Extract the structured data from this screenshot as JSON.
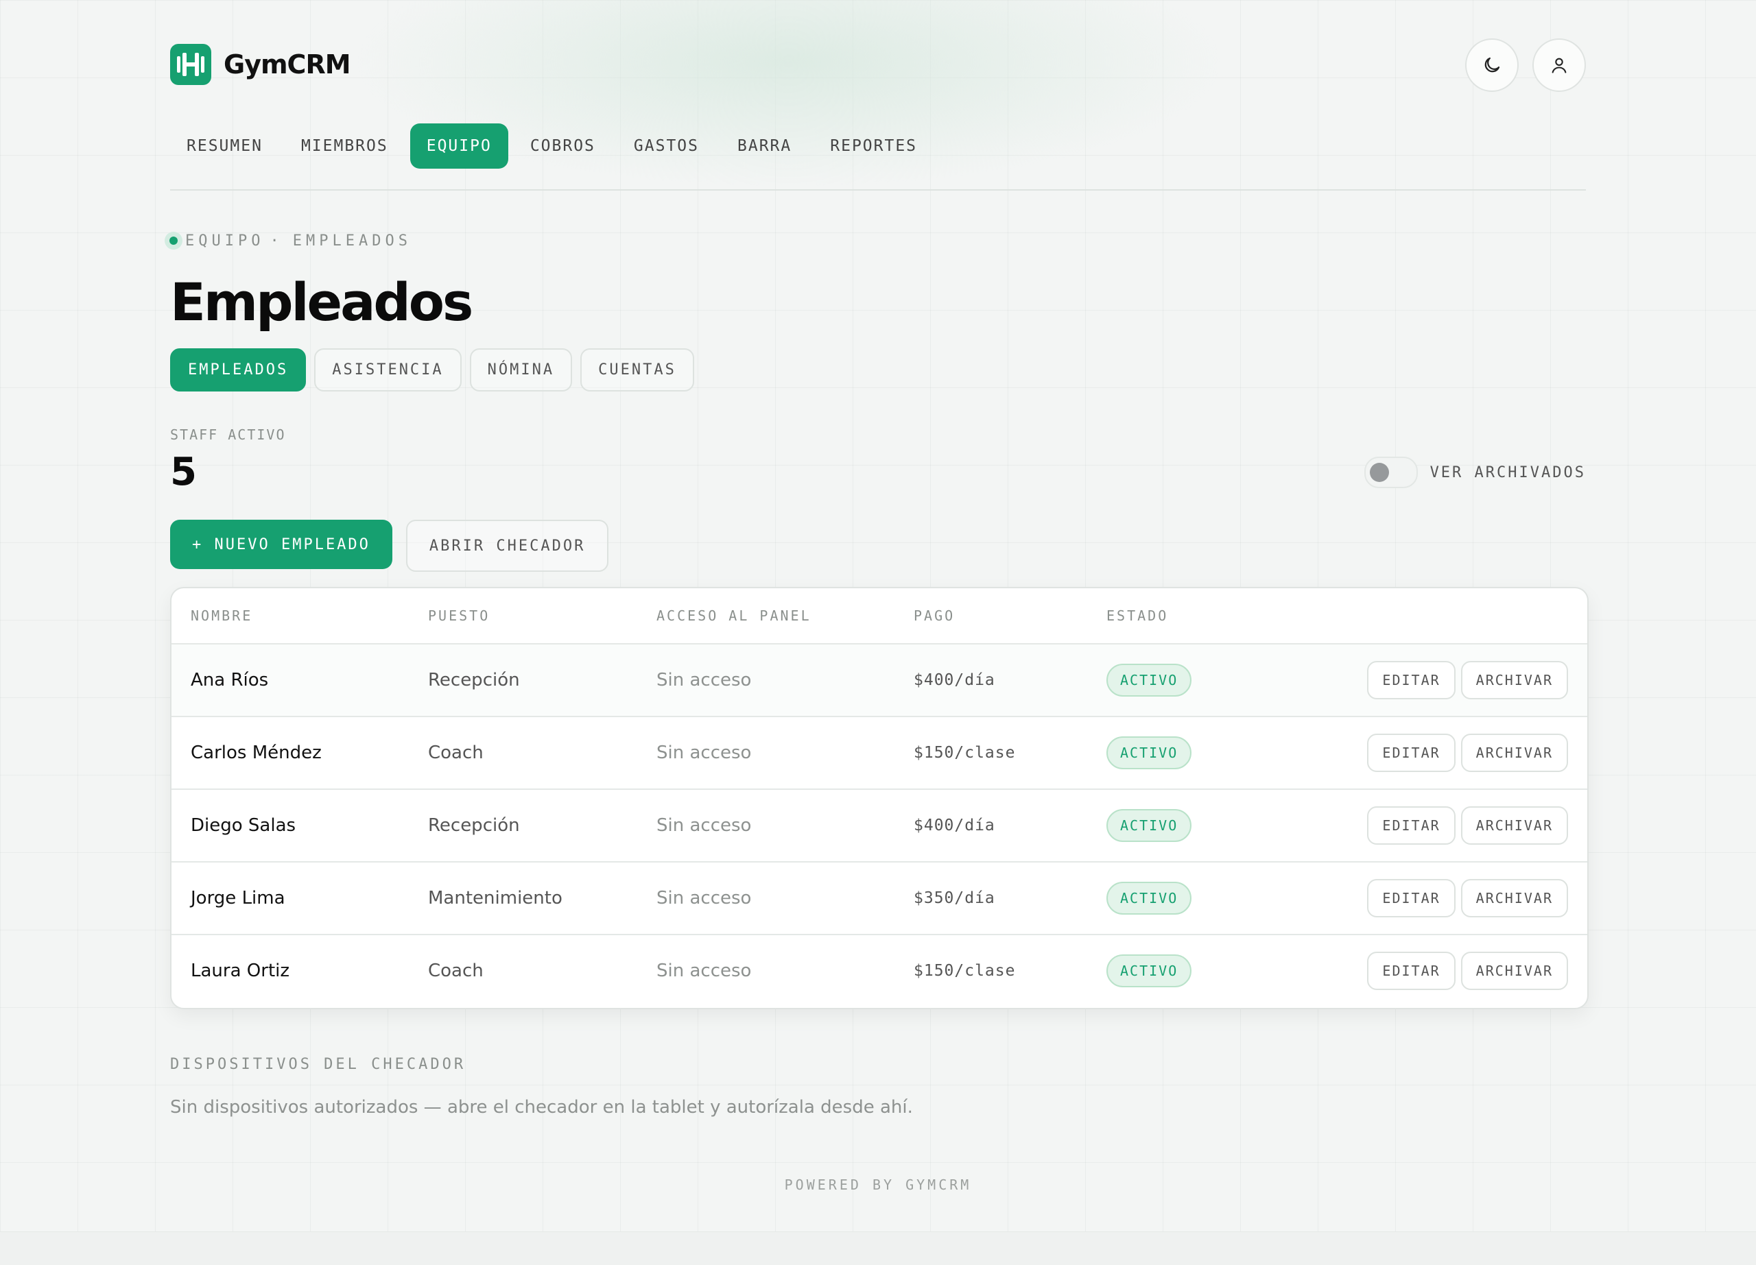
{
  "app": {
    "brand": "GymCRM"
  },
  "header": {
    "theme_icon": "moon-icon",
    "user_icon": "user-icon"
  },
  "nav": {
    "items": [
      {
        "label": "RESUMEN"
      },
      {
        "label": "MIEMBROS"
      },
      {
        "label": "EQUIPO",
        "active": true
      },
      {
        "label": "COBROS"
      },
      {
        "label": "GASTOS"
      },
      {
        "label": "BARRA"
      },
      {
        "label": "REPORTES"
      }
    ]
  },
  "breadcrumb": {
    "section": "EQUIPO",
    "separator": "·",
    "page": "EMPLEADOS"
  },
  "page": {
    "title": "Empleados"
  },
  "subtabs": [
    {
      "label": "EMPLEADOS",
      "active": true
    },
    {
      "label": "ASISTENCIA"
    },
    {
      "label": "NÓMINA"
    },
    {
      "label": "CUENTAS"
    }
  ],
  "staff": {
    "label": "STAFF ACTIVO",
    "count": "5"
  },
  "archived_toggle": {
    "label": "VER ARCHIVADOS",
    "on": false
  },
  "actions": {
    "new_employee": "+ NUEVO EMPLEADO",
    "open_checker": "ABRIR CHECADOR"
  },
  "table": {
    "headers": {
      "name": "NOMBRE",
      "role": "PUESTO",
      "access": "ACCESO AL PANEL",
      "pay": "PAGO",
      "status": "ESTADO"
    },
    "edit_label": "EDITAR",
    "archive_label": "ARCHIVAR",
    "rows": [
      {
        "name": "Ana Ríos",
        "role": "Recepción",
        "access": "Sin acceso",
        "pay": "$400/día",
        "status": "ACTIVO"
      },
      {
        "name": "Carlos Méndez",
        "role": "Coach",
        "access": "Sin acceso",
        "pay": "$150/clase",
        "status": "ACTIVO"
      },
      {
        "name": "Diego Salas",
        "role": "Recepción",
        "access": "Sin acceso",
        "pay": "$400/día",
        "status": "ACTIVO"
      },
      {
        "name": "Jorge Lima",
        "role": "Mantenimiento",
        "access": "Sin acceso",
        "pay": "$350/día",
        "status": "ACTIVO"
      },
      {
        "name": "Laura Ortiz",
        "role": "Coach",
        "access": "Sin acceso",
        "pay": "$150/clase",
        "status": "ACTIVO"
      }
    ]
  },
  "devices": {
    "label": "DISPOSITIVOS DEL CHECADOR",
    "empty_text": "Sin dispositivos autorizados — abre el checador en la tablet y autorízala desde ahí."
  },
  "footer": {
    "text": "POWERED BY GYMCRM"
  },
  "colors": {
    "accent": "#16a070",
    "badge_bg": "#e3f4ea",
    "muted": "#8a8f8c"
  }
}
